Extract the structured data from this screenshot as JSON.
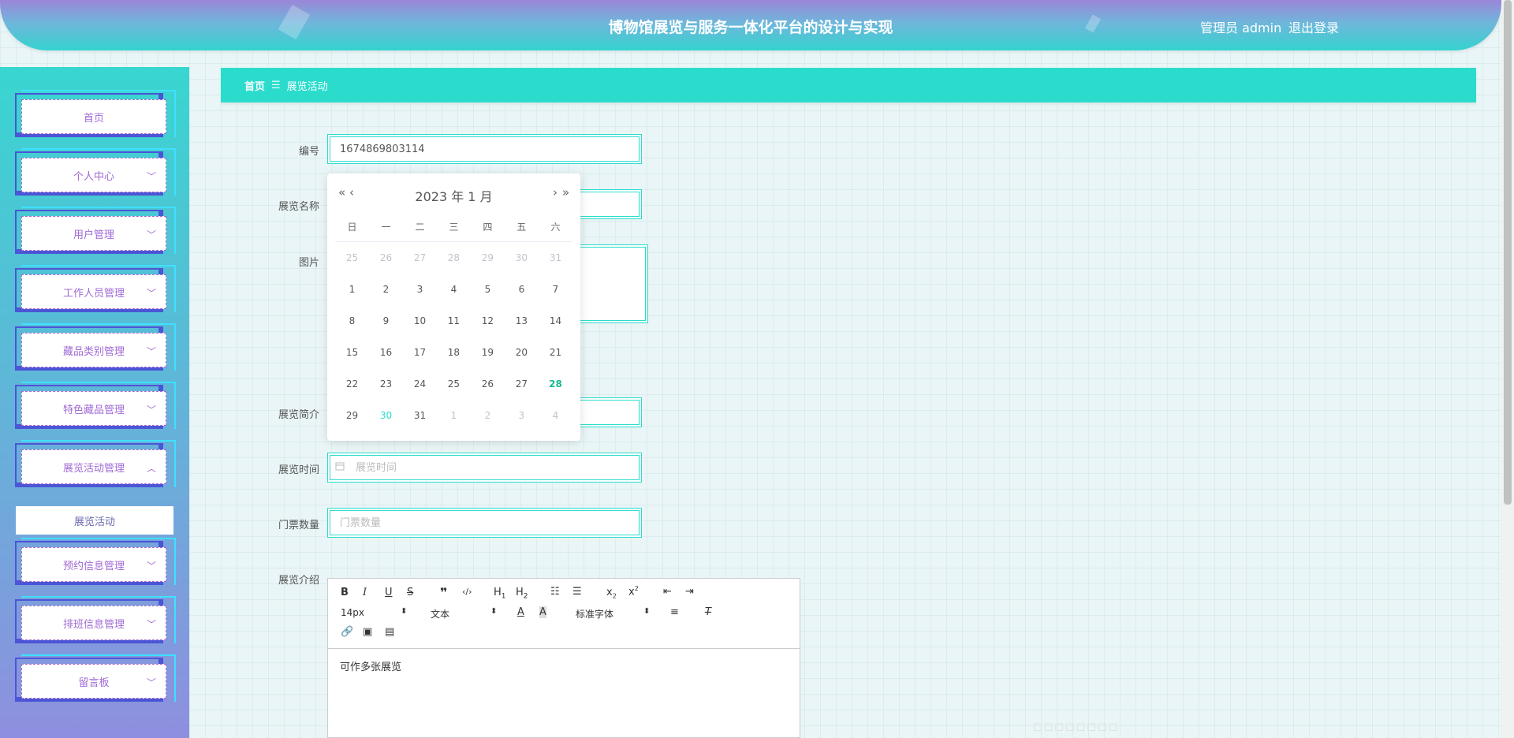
{
  "header": {
    "title": "博物馆展览与服务一体化平台的设计与实现",
    "user": "管理员 admin",
    "logout": "退出登录"
  },
  "sidebar": {
    "items": [
      {
        "label": "首页",
        "chevron": ""
      },
      {
        "label": "个人中心",
        "chevron": "﹀"
      },
      {
        "label": "用户管理",
        "chevron": "﹀"
      },
      {
        "label": "工作人员管理",
        "chevron": "﹀"
      },
      {
        "label": "藏品类别管理",
        "chevron": "﹀"
      },
      {
        "label": "特色藏品管理",
        "chevron": "﹀"
      },
      {
        "label": "展览活动管理",
        "chevron": "︿"
      },
      {
        "label": "预约信息管理",
        "chevron": "﹀"
      },
      {
        "label": "排班信息管理",
        "chevron": "﹀"
      },
      {
        "label": "留言板",
        "chevron": "﹀"
      }
    ],
    "sub_item": "展览活动"
  },
  "breadcrumb": {
    "home": "首页",
    "sep": "☰",
    "current": "展览活动"
  },
  "form": {
    "labels": {
      "id": "编号",
      "name": "展览名称",
      "image": "图片",
      "intro": "展览简介",
      "time": "展览时间",
      "tickets": "门票数量",
      "detail": "展览介绍"
    },
    "id_value": "1674869803114",
    "time_placeholder": "展览时间",
    "tickets_placeholder": "门票数量"
  },
  "datepicker": {
    "prev_year": "«",
    "prev_month": "‹",
    "next_month": "›",
    "next_year": "»",
    "year_month": "2023 年  1 月",
    "weekdays": [
      "日",
      "一",
      "二",
      "三",
      "四",
      "五",
      "六"
    ],
    "weeks": [
      [
        "25",
        "26",
        "27",
        "28",
        "29",
        "30",
        "31"
      ],
      [
        "1",
        "2",
        "3",
        "4",
        "5",
        "6",
        "7"
      ],
      [
        "8",
        "9",
        "10",
        "11",
        "12",
        "13",
        "14"
      ],
      [
        "15",
        "16",
        "17",
        "18",
        "19",
        "20",
        "21"
      ],
      [
        "22",
        "23",
        "24",
        "25",
        "26",
        "27",
        "28"
      ],
      [
        "29",
        "30",
        "31",
        "1",
        "2",
        "3",
        "4"
      ]
    ],
    "today": "28",
    "hover": "30"
  },
  "editor": {
    "font_size": "14px",
    "block_type": "文本",
    "font_family": "标准字体",
    "content": "可作多张展览"
  }
}
